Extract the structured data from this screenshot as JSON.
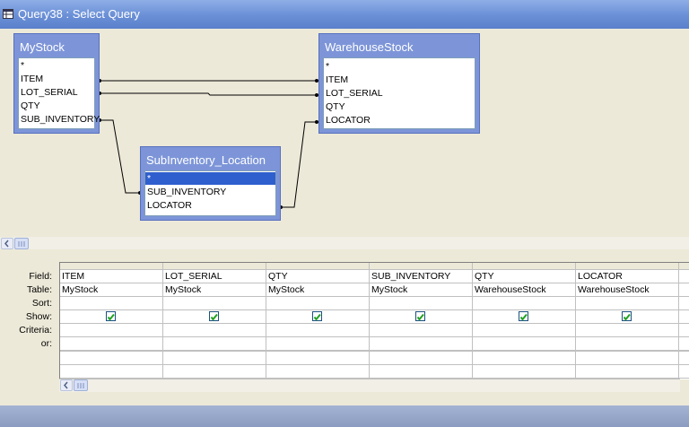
{
  "window": {
    "title": "Query38 : Select Query"
  },
  "tables": [
    {
      "name": "MyStock",
      "fields": [
        "*",
        "ITEM",
        "LOT_SERIAL",
        "QTY",
        "SUB_INVENTORY"
      ]
    },
    {
      "name": "WarehouseStock",
      "fields": [
        "*",
        "ITEM",
        "LOT_SERIAL",
        "QTY",
        "LOCATOR"
      ]
    },
    {
      "name": "SubInventory_Location",
      "fields": [
        "*",
        "SUB_INVENTORY",
        "LOCATOR"
      ]
    }
  ],
  "grid": {
    "row_labels": {
      "field": "Field:",
      "table": "Table:",
      "sort": "Sort:",
      "show": "Show:",
      "criteria": "Criteria:",
      "or": "or:"
    },
    "columns": [
      {
        "field": "ITEM",
        "table": "MyStock",
        "show": true
      },
      {
        "field": "LOT_SERIAL",
        "table": "MyStock",
        "show": true
      },
      {
        "field": "QTY",
        "table": "MyStock",
        "show": true
      },
      {
        "field": "SUB_INVENTORY",
        "table": "MyStock",
        "show": true
      },
      {
        "field": "QTY",
        "table": "WarehouseStock",
        "show": true
      },
      {
        "field": "LOCATOR",
        "table": "WarehouseStock",
        "show": true
      }
    ]
  },
  "colors": {
    "title_bar": "#6a8fd6",
    "table_header": "#7d95d8",
    "selection": "#2f5fce",
    "checkbox_mark": "#21a121"
  }
}
